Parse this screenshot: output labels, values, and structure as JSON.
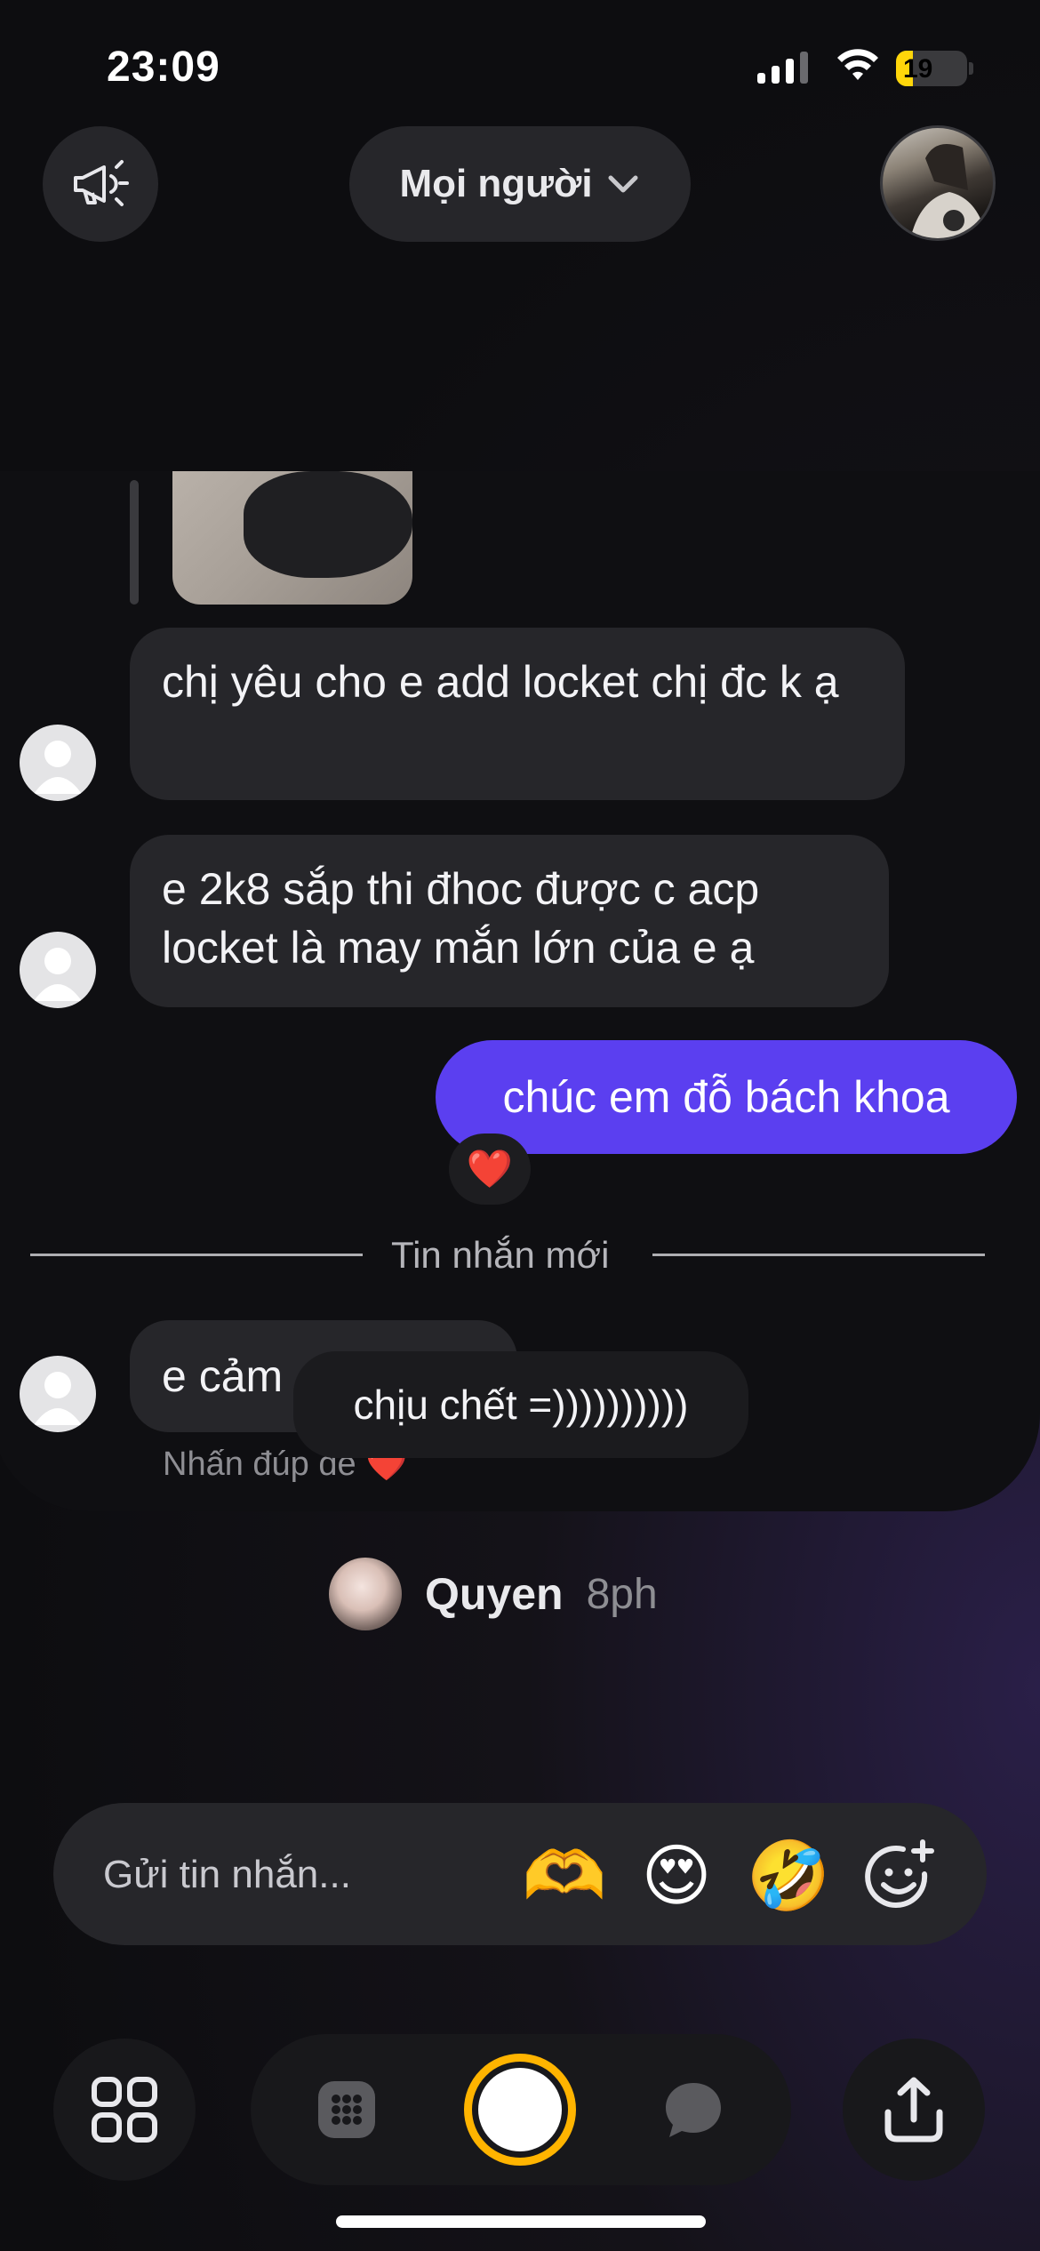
{
  "status_bar": {
    "time": "23:09",
    "battery": "19"
  },
  "header": {
    "filter_label": "Mọi người"
  },
  "messages": [
    {
      "from": "them",
      "text": "chị yêu cho e add locket chị đc k ạ"
    },
    {
      "from": "them",
      "text": "e 2k8 sắp thi đhoc được c acp locket là may mắn lớn của e ạ"
    },
    {
      "from": "me",
      "text": "chúc em đỗ bách khoa",
      "reaction": "❤️"
    },
    {
      "from": "them",
      "text": "e cảm"
    }
  ],
  "divider_label": "Tin nhắn mới",
  "floating_reply": "chịu chết =))))))))))",
  "double_tap_hint": "Nhấn đúp để",
  "double_tap_heart": "❤️",
  "sender": {
    "name": "Quyen",
    "time": "8ph"
  },
  "composer": {
    "placeholder": "Gửi tin nhắn...",
    "quick_reactions": [
      "🫶",
      "😍",
      "🤣"
    ]
  },
  "colors": {
    "accent": "#5b3ff0",
    "shutter": "#ffb400",
    "battery": "#ffd60a"
  },
  "icons": {
    "header_left": "megaphone-icon",
    "composer_right": "add-emoji-icon",
    "nav": [
      "grid-icon",
      "calendar-icon",
      "camera-shutter",
      "chat-icon",
      "share-icon"
    ]
  }
}
